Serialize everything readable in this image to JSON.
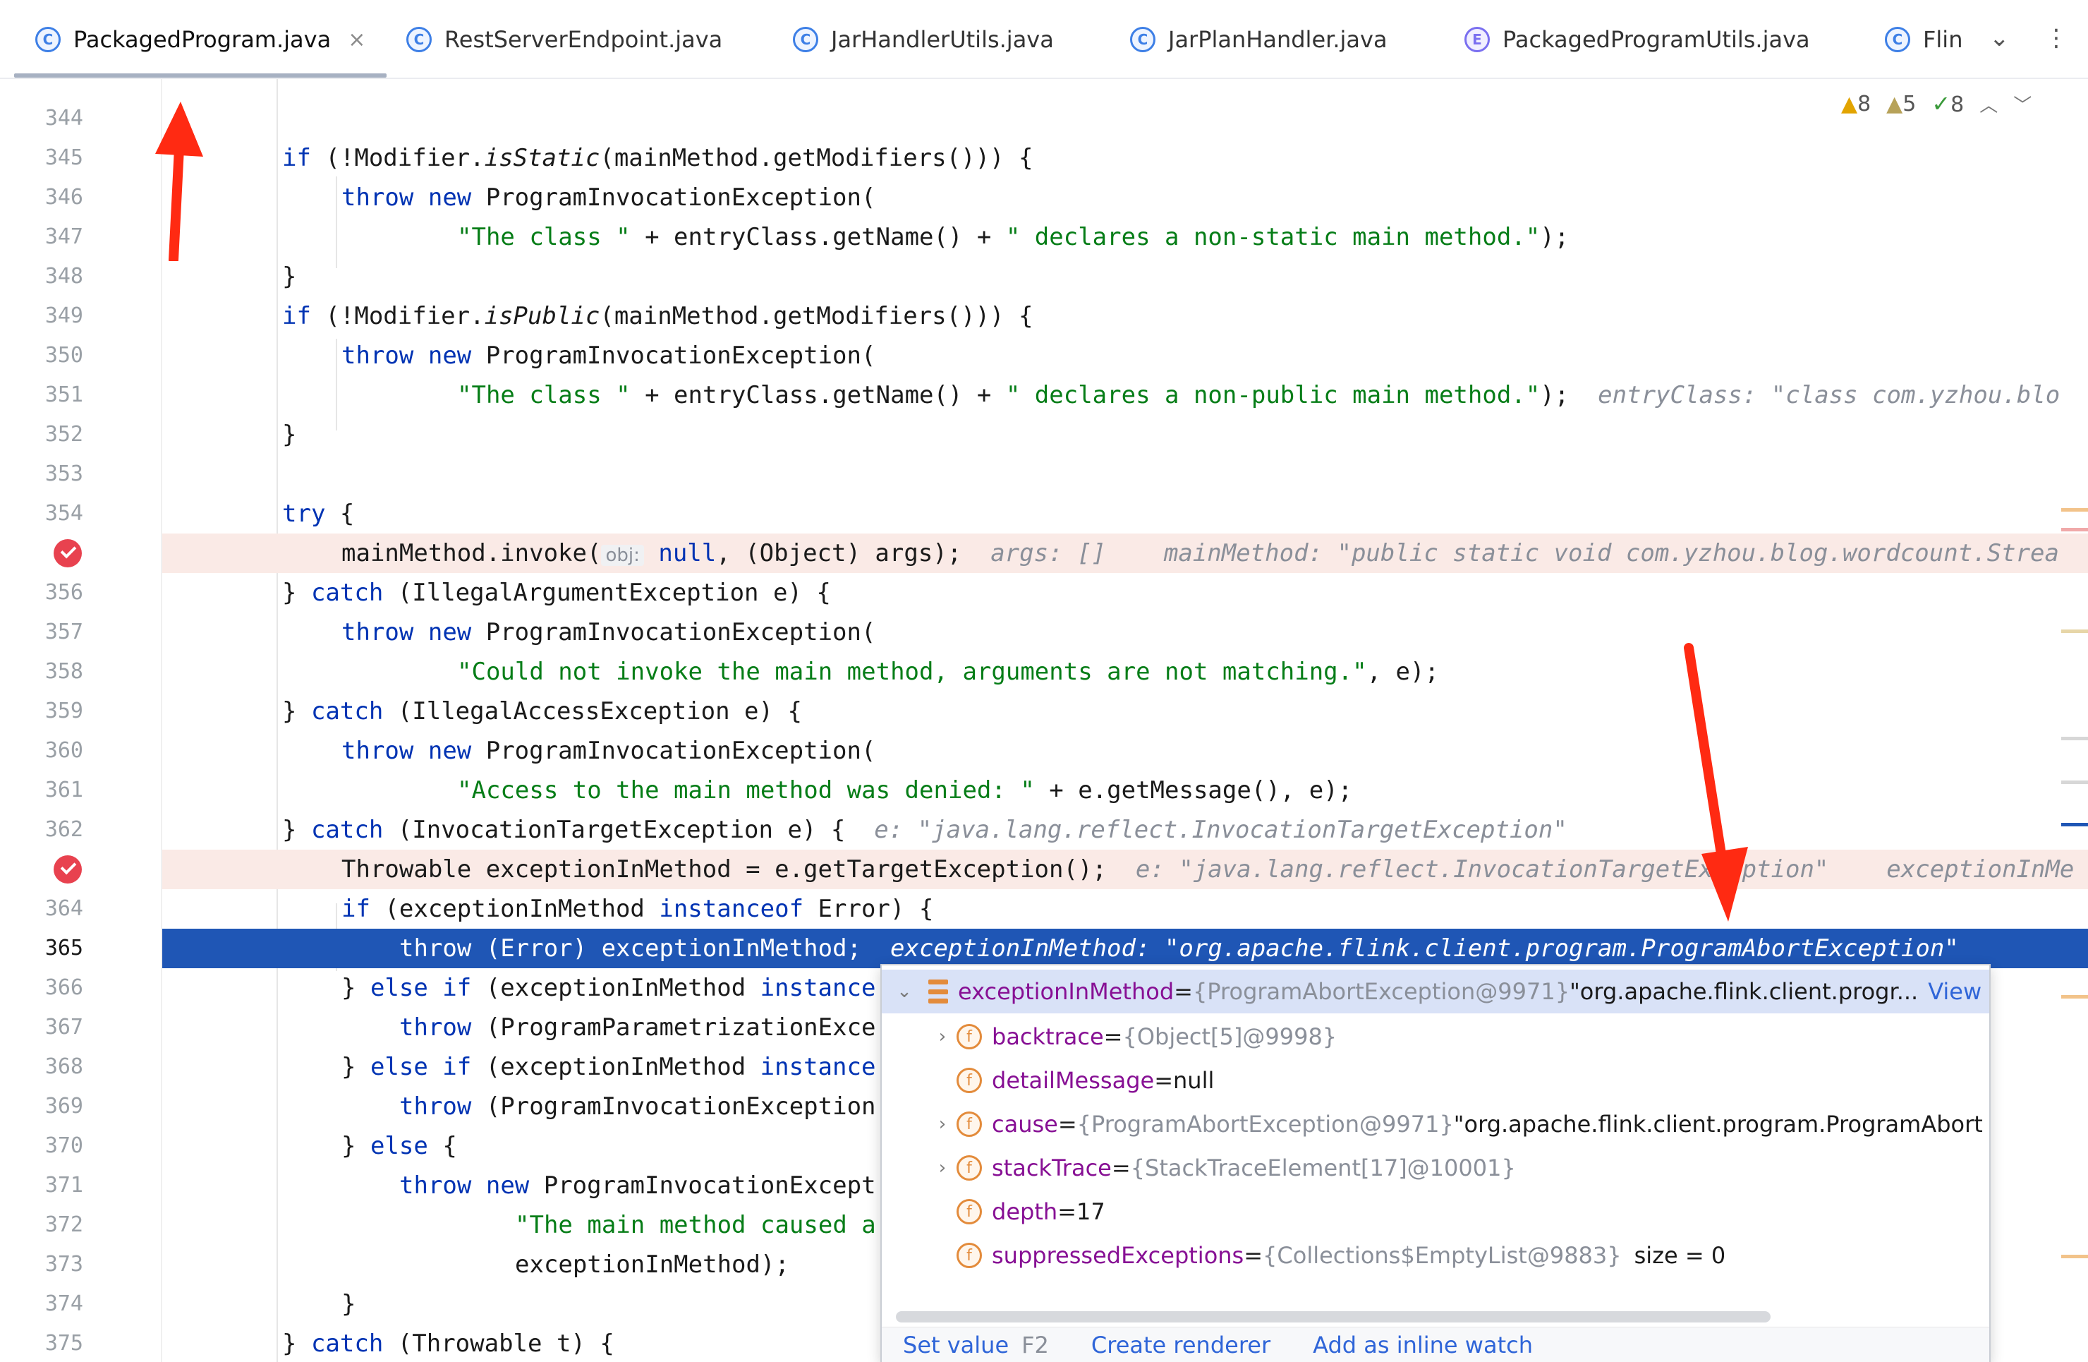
{
  "tabs": [
    {
      "label": "PackagedProgram.java",
      "icon": "class-icon",
      "active": true,
      "closable": true
    },
    {
      "label": "RestServerEndpoint.java",
      "icon": "class-icon"
    },
    {
      "label": "JarHandlerUtils.java",
      "icon": "class-icon"
    },
    {
      "label": "JarPlanHandler.java",
      "icon": "class-icon"
    },
    {
      "label": "PackagedProgramUtils.java",
      "icon": "enum-icon"
    },
    {
      "label": "Flin",
      "icon": "class-icon"
    }
  ],
  "inspections": {
    "errors": "8",
    "warnings": "5",
    "ok": "8"
  },
  "editor": {
    "lines": [
      {
        "n": "344"
      },
      {
        "n": "345"
      },
      {
        "n": "346"
      },
      {
        "n": "347"
      },
      {
        "n": "348"
      },
      {
        "n": "349"
      },
      {
        "n": "350"
      },
      {
        "n": "351"
      },
      {
        "n": "352"
      },
      {
        "n": "353"
      },
      {
        "n": "354"
      },
      {
        "n": "355",
        "breakpoint": true
      },
      {
        "n": "356"
      },
      {
        "n": "357"
      },
      {
        "n": "358"
      },
      {
        "n": "359"
      },
      {
        "n": "360"
      },
      {
        "n": "361"
      },
      {
        "n": "362"
      },
      {
        "n": "363",
        "breakpoint": true
      },
      {
        "n": "364"
      },
      {
        "n": "365",
        "current": true
      },
      {
        "n": "366"
      },
      {
        "n": "367"
      },
      {
        "n": "368"
      },
      {
        "n": "369"
      },
      {
        "n": "370"
      },
      {
        "n": "371"
      },
      {
        "n": "372"
      },
      {
        "n": "373"
      },
      {
        "n": "374"
      },
      {
        "n": "375"
      }
    ],
    "code": {
      "l345_a": "if",
      "l345_b": " (!Modifier.",
      "l345_c": "isStatic",
      "l345_d": "(mainMethod.getModifiers())) {",
      "l346_a": "throw",
      "l346_b": "new",
      "l346_c": " ProgramInvocationException(",
      "l347_a": "\"The class \"",
      "l347_b": " + entryClass.getName() + ",
      "l347_c": "\" declares a non-static main method.\"",
      "l347_d": ");",
      "l348": "}",
      "l349_a": "if",
      "l349_b": " (!Modifier.",
      "l349_c": "isPublic",
      "l349_d": "(mainMethod.getModifiers())) {",
      "l350_a": "throw",
      "l350_b": "new",
      "l350_c": " ProgramInvocationException(",
      "l351_a": "\"The class \"",
      "l351_b": " + entryClass.getName() + ",
      "l351_c": "\" declares a non-public main method.\"",
      "l351_d": ");",
      "l351_hint": "entryClass: \"class com.yzhou.blo",
      "l352": "}",
      "l354_a": "try",
      "l354_b": " {",
      "l355_a": "mainMethod.invoke(",
      "l355_obj": "obj:",
      "l355_b": "null",
      "l355_c": ", (Object) args);",
      "l355_hint1": "args: []",
      "l355_hint2": "mainMethod: \"public static void com.yzhou.blog.wordcount.Strea",
      "l356_a": "} ",
      "l356_b": "catch",
      "l356_c": " (IllegalArgumentException e) {",
      "l357_a": "throw",
      "l357_b": "new",
      "l357_c": " ProgramInvocationException(",
      "l358_a": "\"Could not invoke the main method, arguments are not matching.\"",
      "l358_b": ", e);",
      "l359_a": "} ",
      "l359_b": "catch",
      "l359_c": " (IllegalAccessException e) {",
      "l360_a": "throw",
      "l360_b": "new",
      "l360_c": " ProgramInvocationException(",
      "l361_a": "\"Access to the main method was denied: \"",
      "l361_b": " + e.getMessage(), e);",
      "l362_a": "} ",
      "l362_b": "catch",
      "l362_c": " (InvocationTargetException e) {",
      "l362_hint": "e: \"java.lang.reflect.InvocationTargetException\"",
      "l363_a": "Throwable exceptionInMethod = e.getTargetException();",
      "l363_hint1": "e: \"java.lang.reflect.InvocationTargetException\"",
      "l363_hint2": "exceptionInMe",
      "l364_a": "if",
      "l364_b": " (exceptionInMethod ",
      "l364_c": "instanceof",
      "l364_d": " Error) {",
      "l365_a": "throw",
      "l365_b": " (Error) exceptionInMethod;",
      "l365_hint": "exceptionInMethod: \"org.apache.flink.client.program.ProgramAbortException\"",
      "l366_a": "} ",
      "l366_b": "else if",
      "l366_c": " (exceptionInMethod ",
      "l366_d": "instance",
      "l367_a": "throw",
      "l367_b": " (ProgramParametrizationExce",
      "l368_a": "} ",
      "l368_b": "else if",
      "l368_c": " (exceptionInMethod ",
      "l368_d": "instance",
      "l369_a": "throw",
      "l369_b": " (ProgramInvocationException",
      "l370_a": "} ",
      "l370_b": "else",
      "l370_c": " {",
      "l371_a": "throw",
      "l371_b": "new",
      "l371_c": " ProgramInvocationExcept",
      "l372_a": "\"The main method caused a",
      "l373_a": "exceptionInMethod);",
      "l374": "}",
      "l375_a": "} ",
      "l375_b": "catch",
      "l375_c": " (Throwable t) {"
    }
  },
  "debug_popup": {
    "root": {
      "name": "exceptionInMethod",
      "eq": " = ",
      "type": "{ProgramAbortException@9971}",
      "value": " \"org.apache.flink.client.progr...",
      "link": "View"
    },
    "fields": [
      {
        "name": "backtrace",
        "type": "{Object[5]@9998}",
        "value": "",
        "expandable": true
      },
      {
        "name": "detailMessage",
        "type": "",
        "value": "null",
        "expandable": false
      },
      {
        "name": "cause",
        "type": "{ProgramAbortException@9971}",
        "value": " \"org.apache.flink.client.program.ProgramAbort",
        "expandable": true
      },
      {
        "name": "stackTrace",
        "type": "{StackTraceElement[17]@10001}",
        "value": "",
        "expandable": true
      },
      {
        "name": "depth",
        "type": "",
        "value": "17",
        "expandable": false
      },
      {
        "name": "suppressedExceptions",
        "type": "{Collections$EmptyList@9883}",
        "value": "size = 0",
        "expandable": false
      }
    ],
    "footer": {
      "set_value": "Set value",
      "set_value_key": "F2",
      "create_renderer": "Create renderer",
      "add_inline_watch": "Add as inline watch"
    }
  },
  "colors": {
    "accent": "#1f56b5",
    "breakpoint": "#e8424f",
    "annotation_arrow": "#ff2a12"
  }
}
